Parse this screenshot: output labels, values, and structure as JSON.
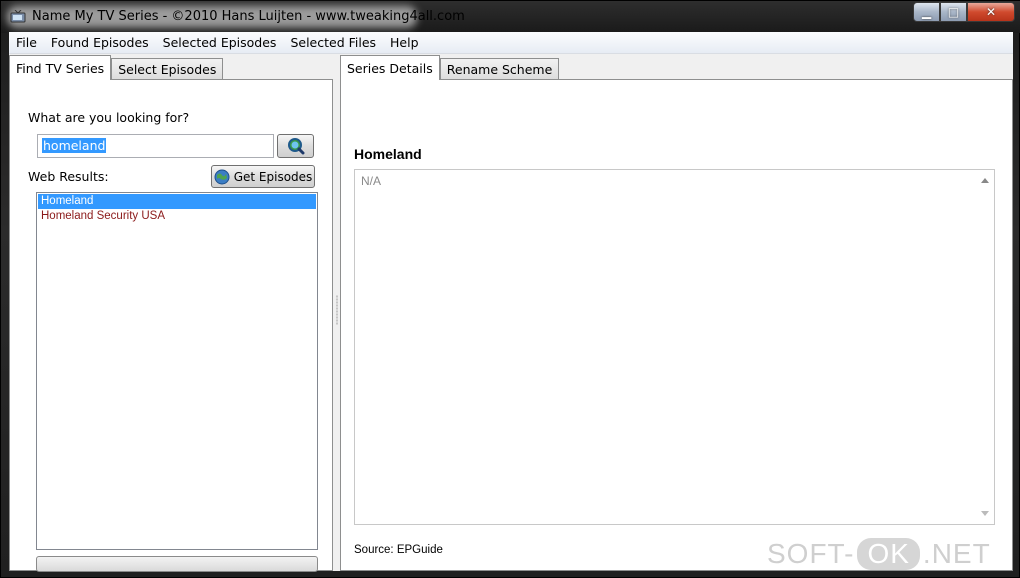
{
  "window": {
    "title": "Name My TV Series - ©2010 Hans Luijten - www.tweaking4all.com",
    "icon": "tv-app-icon",
    "controls": {
      "minimize": "▁",
      "maximize": "□",
      "close": "✕"
    }
  },
  "menu": {
    "items": [
      "File",
      "Found Episodes",
      "Selected Episodes",
      "Selected Files",
      "Help"
    ]
  },
  "left_tabs": [
    "Find TV Series",
    "Select Episodes"
  ],
  "search": {
    "label": "What are you looking for?",
    "value": "homeland",
    "button_icon": "search-globe-icon"
  },
  "web_results": {
    "label": "Web Results:",
    "get_episodes_label": "Get Episodes",
    "get_episodes_icon": "globe-icon",
    "items": [
      "Homeland",
      "Homeland Security USA"
    ],
    "selected_index": 0
  },
  "progress": {
    "fraction": 0
  },
  "right_tabs": [
    "Series Details",
    "Rename Scheme"
  ],
  "details": {
    "series_title": "Homeland",
    "description": "N/A",
    "source": "Source: EPGuide"
  },
  "watermark": {
    "left": "SOFT-",
    "ok": "OK",
    "right": ".NET"
  },
  "colors": {
    "selection": "#3399ff",
    "result_text": "#8b1a1a",
    "close_button": "#d04a2e"
  }
}
